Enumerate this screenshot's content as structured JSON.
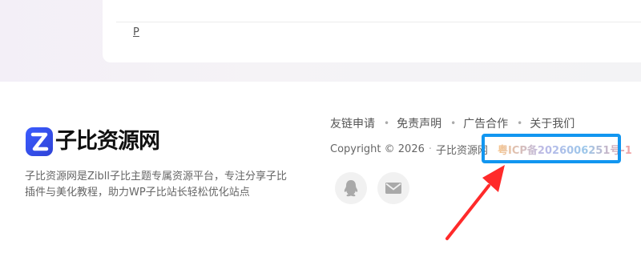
{
  "card": {
    "link_text": "P"
  },
  "brand": {
    "name": "子比资源网"
  },
  "description": "子比资源网是Zibll子比主题专属资源平台，专注分享子比插件与美化教程，助力WP子比站长轻松优化站点",
  "links": [
    "友链申请",
    "免责声明",
    "广告合作",
    "关于我们"
  ],
  "copyright": {
    "text": "Copyright © 2026",
    "separator": "·",
    "site": "子比资源网",
    "icp": "粤ICP备2026006251号-1"
  },
  "icons": {
    "qq": "qq-icon",
    "mail": "mail-icon",
    "arrow": "red-arrow-annotation"
  },
  "colors": {
    "highlight_box": "#1296f0",
    "arrow": "#ff2a2a",
    "brand_blue": "#3b5cff"
  }
}
